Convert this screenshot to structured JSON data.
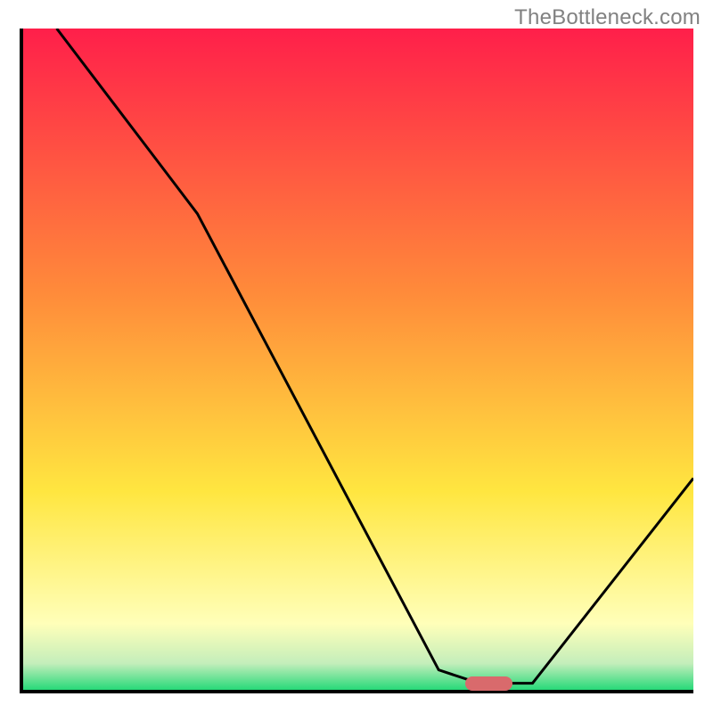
{
  "watermark": "TheBottleneck.com",
  "colors": {
    "gradient_top": "#ff1f4a",
    "gradient_orange": "#ff8b3a",
    "gradient_yellow": "#ffe640",
    "gradient_pale_yellow": "#ffffb9",
    "gradient_pale_green": "#c4eebb",
    "gradient_green": "#27d979",
    "frame": "#000000",
    "curve": "#000000",
    "marker": "#d96a6c",
    "watermark_text": "#818181"
  },
  "chart_data": {
    "type": "line",
    "title": "",
    "xlabel": "",
    "ylabel": "",
    "xlim": [
      0,
      100
    ],
    "ylim": [
      0,
      100
    ],
    "x": [
      5,
      20,
      26,
      62,
      68,
      76,
      100
    ],
    "values": [
      100,
      80,
      72,
      3,
      1,
      1,
      32
    ],
    "marker": {
      "x_start": 66,
      "x_end": 73,
      "y": 1
    },
    "grid": false,
    "legend": false
  }
}
